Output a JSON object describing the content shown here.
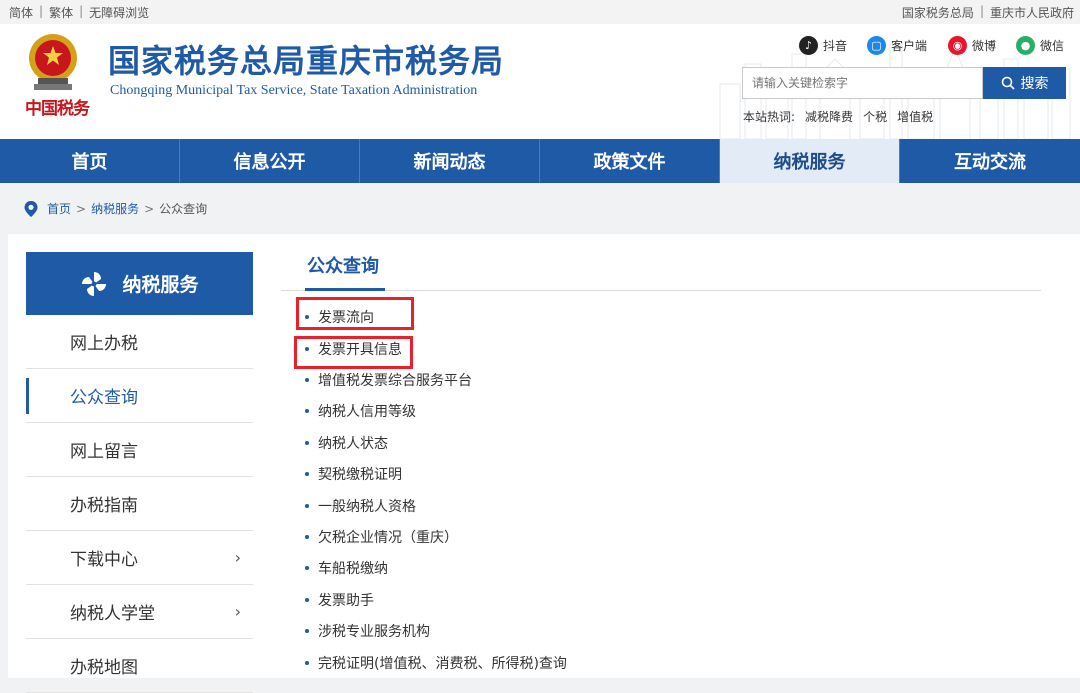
{
  "topbar": {
    "left": [
      "简体",
      "繁体",
      "无障碍浏览"
    ],
    "right": [
      "国家税务总局",
      "重庆市人民政府"
    ]
  },
  "header": {
    "emblem_text": "中国税务",
    "title": "国家税务总局重庆市税务局",
    "subtitle": "Chongqing Municipal Tax Service, State Taxation Administration",
    "social": [
      {
        "label": "抖音",
        "icon": "douyin-icon",
        "color": "#222222"
      },
      {
        "label": "客户端",
        "icon": "app-client-icon",
        "color": "#1e88e5"
      },
      {
        "label": "微博",
        "icon": "weibo-icon",
        "color": "#e6162d"
      },
      {
        "label": "微信",
        "icon": "wechat-icon",
        "color": "#2aae67"
      }
    ],
    "search_placeholder": "请输入关键检索字",
    "search_button": "搜索",
    "hot_label": "本站热词:",
    "hot_words": [
      "减税降费",
      "个税",
      "增值税"
    ]
  },
  "nav": {
    "items": [
      "首页",
      "信息公开",
      "新闻动态",
      "政策文件",
      "纳税服务",
      "互动交流"
    ],
    "active": "纳税服务"
  },
  "breadcrumb": {
    "home": "首页",
    "section": "纳税服务",
    "current": "公众查询",
    "separator": ">"
  },
  "sidebar": {
    "heading": "纳税服务",
    "items": [
      {
        "label": "网上办税",
        "active": false,
        "arrow": false
      },
      {
        "label": "公众查询",
        "active": true,
        "arrow": false
      },
      {
        "label": "网上留言",
        "active": false,
        "arrow": false
      },
      {
        "label": "办税指南",
        "active": false,
        "arrow": false
      },
      {
        "label": "下载中心",
        "active": false,
        "arrow": true
      },
      {
        "label": "纳税人学堂",
        "active": false,
        "arrow": true
      },
      {
        "label": "办税地图",
        "active": false,
        "arrow": false
      }
    ]
  },
  "main": {
    "title": "公众查询",
    "links": [
      "发票流向",
      "发票开具信息",
      "增值税发票综合服务平台",
      "纳税人信用等级",
      "纳税人状态",
      "契税缴税证明",
      "一般纳税人资格",
      "欠税企业情况（重庆）",
      "车船税缴纳",
      "发票助手",
      "涉税专业服务机构",
      "完税证明(增值税、消费税、所得税)查询"
    ]
  },
  "colors": {
    "brand_blue": "#1f5aa6",
    "highlight_red": "#e8212a"
  }
}
